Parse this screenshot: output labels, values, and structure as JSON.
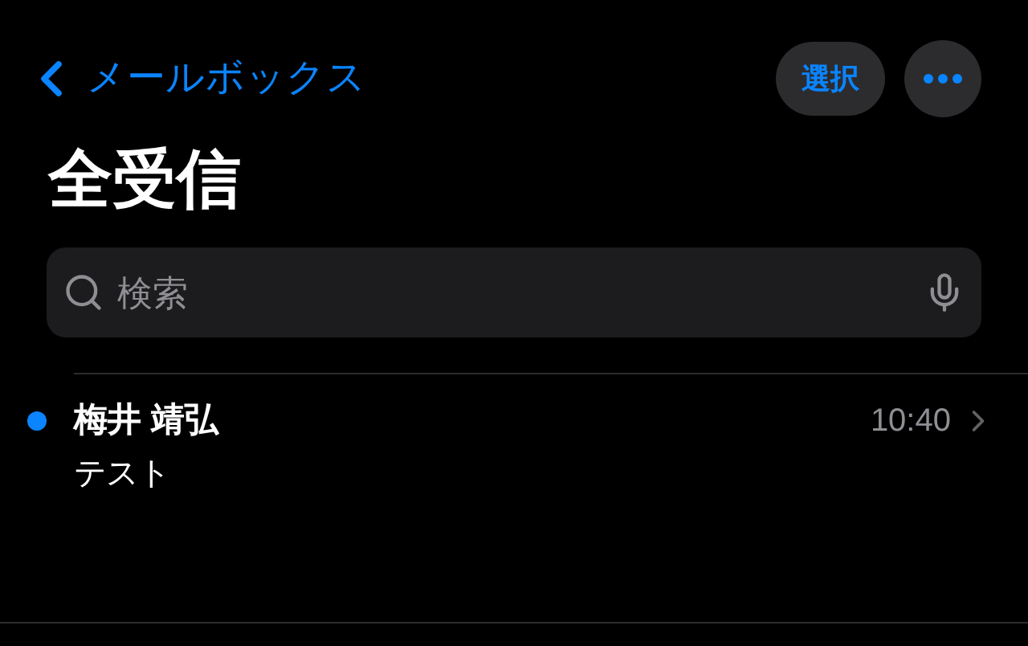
{
  "nav": {
    "back_label": "メールボックス",
    "select_button": "選択"
  },
  "title": "全受信",
  "search": {
    "placeholder": "検索"
  },
  "messages": [
    {
      "sender": "梅井 靖弘",
      "time": "10:40",
      "subject": "テスト",
      "unread": true
    }
  ]
}
